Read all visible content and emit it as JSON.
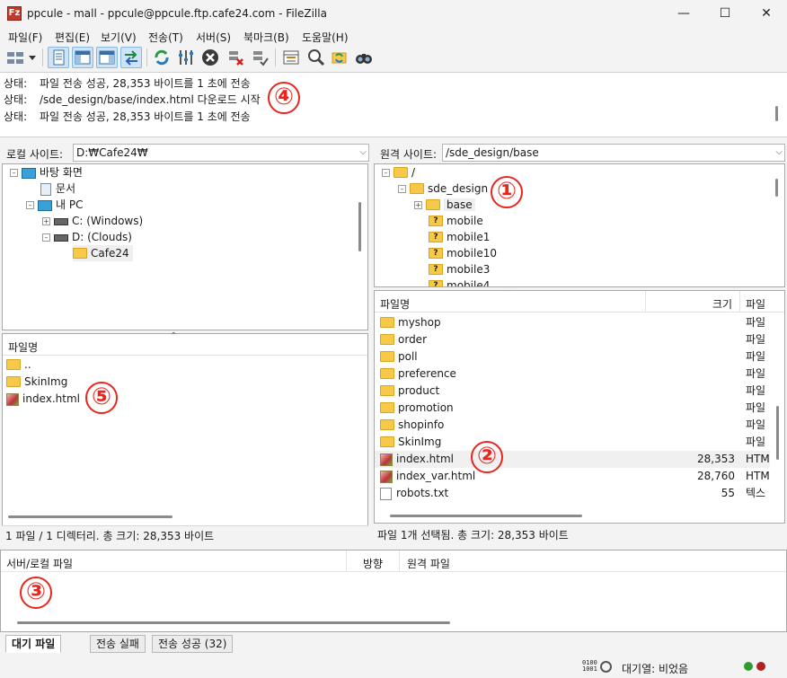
{
  "window": {
    "title": "ppcule - mall - ppcule@ppcule.ftp.cafe24.com - FileZilla",
    "app_icon_glyph": "Fz",
    "minimize_glyph": "—",
    "maximize_glyph": "☐",
    "close_glyph": "✕"
  },
  "menu": [
    "파일(F)",
    "편집(E)",
    "보기(V)",
    "전송(T)",
    "서버(S)",
    "북마크(B)",
    "도움말(H)"
  ],
  "toolbar_icons": [
    "site-manager-icon",
    "dropdown-icon",
    "toggle-log-icon",
    "toggle-local-tree-icon",
    "toggle-remote-tree-icon",
    "toggle-queue-icon",
    "refresh-icon",
    "process-queue-icon",
    "cancel-icon",
    "disconnect-icon",
    "reconnect-icon",
    "directory-listing-filter-icon",
    "search-icon",
    "sync-browse-icon",
    "find-files-icon"
  ],
  "log": [
    {
      "label": "상태:",
      "text": "파일 전송 성공, 28,353 바이트를 1 초에 전송"
    },
    {
      "label": "상태:",
      "text": "/sde_design/base/index.html 다운로드 시작"
    },
    {
      "label": "상태:",
      "text": "파일 전송 성공, 28,353 바이트를 1 초에 전송"
    }
  ],
  "local": {
    "site_label": "로컬 사이트:",
    "path": "D:₩Cafe24₩",
    "tree": [
      {
        "text": "바탕 화면",
        "icon": "desktop-icon"
      },
      {
        "text": "문서",
        "icon": "documents-icon"
      },
      {
        "text": "내 PC",
        "icon": "pc-icon"
      },
      {
        "text": "C: (Windows)",
        "icon": "drive-icon"
      },
      {
        "text": "D: (Clouds)",
        "icon": "drive-icon"
      },
      {
        "text": "Cafe24",
        "icon": "folder-icon"
      }
    ],
    "list_header": "파일명",
    "files": [
      {
        "name": "..",
        "icon": "folder-icon"
      },
      {
        "name": "SkinImg",
        "icon": "folder-icon"
      },
      {
        "name": "index.html",
        "icon": "html-file-icon"
      }
    ],
    "status": "1 파일 / 1 디렉터리. 총 크기: 28,353 바이트"
  },
  "remote": {
    "site_label": "원격 사이트:",
    "path": "/sde_design/base",
    "tree": [
      {
        "text": "/",
        "icon": "folder-icon"
      },
      {
        "text": "sde_design",
        "icon": "folder-icon"
      },
      {
        "text": "base",
        "icon": "folder-icon"
      },
      {
        "text": "mobile",
        "icon": "unknown-folder-icon"
      },
      {
        "text": "mobile1",
        "icon": "unknown-folder-icon"
      },
      {
        "text": "mobile10",
        "icon": "unknown-folder-icon"
      },
      {
        "text": "mobile3",
        "icon": "unknown-folder-icon"
      },
      {
        "text": "mobile4",
        "icon": "unknown-folder-icon"
      }
    ],
    "list_headers": {
      "name": "파일명",
      "size": "크기",
      "type": "파일"
    },
    "files": [
      {
        "name": "myshop",
        "size": "",
        "type": "파일",
        "icon": "folder-icon"
      },
      {
        "name": "order",
        "size": "",
        "type": "파일",
        "icon": "folder-icon"
      },
      {
        "name": "poll",
        "size": "",
        "type": "파일",
        "icon": "folder-icon"
      },
      {
        "name": "preference",
        "size": "",
        "type": "파일",
        "icon": "folder-icon"
      },
      {
        "name": "product",
        "size": "",
        "type": "파일",
        "icon": "folder-icon"
      },
      {
        "name": "promotion",
        "size": "",
        "type": "파일",
        "icon": "folder-icon"
      },
      {
        "name": "shopinfo",
        "size": "",
        "type": "파일",
        "icon": "folder-icon"
      },
      {
        "name": "SkinImg",
        "size": "",
        "type": "파일",
        "icon": "folder-icon"
      },
      {
        "name": "index.html",
        "size": "28,353",
        "type": "HTM",
        "icon": "html-file-icon",
        "selected": true
      },
      {
        "name": "index_var.html",
        "size": "28,760",
        "type": "HTM",
        "icon": "html-file-icon"
      },
      {
        "name": "robots.txt",
        "size": "55",
        "type": "텍스",
        "icon": "text-file-icon"
      }
    ],
    "status": "파일 1개 선택됨. 총 크기: 28,353 바이트"
  },
  "queue": {
    "headers": {
      "local": "서버/로컬 파일",
      "direction": "방향",
      "remote": "원격 파일"
    },
    "tabs": [
      "대기 파일",
      "전송 실패",
      "전송 성공 (32)"
    ]
  },
  "statusbar": {
    "queue_text": "대기열: 비었음"
  },
  "annotations": [
    "①",
    "②",
    "③",
    "④",
    "⑤"
  ],
  "colors": {
    "annotation": "#e8261e",
    "folder": "#f7c948",
    "led_green": "#2e9d2e",
    "led_red": "#b02020"
  }
}
